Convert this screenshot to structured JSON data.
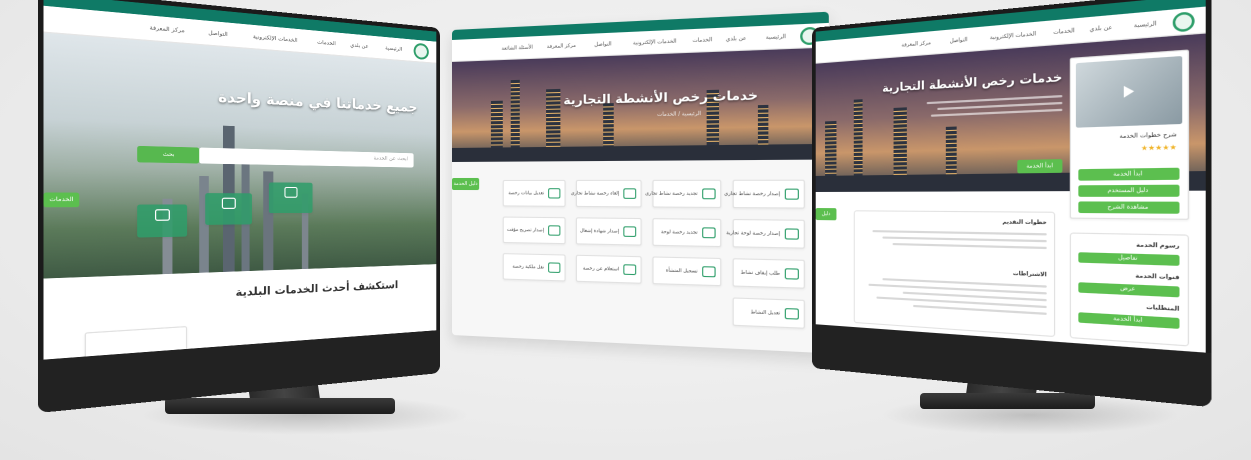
{
  "left_screen": {
    "hero_title_line1": "جميع خدماتنا في منصة واحدة",
    "search_placeholder": "ابحث عن الخدمة",
    "search_button": "بحث",
    "quick_tag": "الخدمات",
    "section_title": "استكشف أحدث الخدمات البلدية",
    "nav_items": [
      "الرئيسية",
      "عن بلدي",
      "الخدمات",
      "الخدمات الإلكترونية",
      "التواصل",
      "مركز المعرفة"
    ]
  },
  "middle_screen": {
    "hero_title": "خدمات رخص الأنشطة التجارية",
    "hero_sub": "الرئيسية / الخدمات",
    "side_tag": "دليل الخدمة",
    "nav_items": [
      "الرئيسية",
      "عن بلدي",
      "الخدمات",
      "الخدمات الإلكترونية",
      "التواصل",
      "مركز المعرفة",
      "الأسئلة الشائعة"
    ],
    "services": [
      "إصدار رخصة نشاط تجاري",
      "تجديد رخصة نشاط تجاري",
      "إلغاء رخصة نشاط تجاري",
      "تعديل بيانات رخصة",
      "إصدار رخصة لوحة تجارية",
      "تجديد رخصة لوحة",
      "إصدار شهادة إشغال",
      "إصدار تصريح مؤقت",
      "طلب إيقاف نشاط",
      "تسجيل المنشأة",
      "استعلام عن رخصة",
      "نقل ملكية رخصة",
      "تعديل النشاط"
    ]
  },
  "right_screen": {
    "hero_title": "خدمات رخص الأنشطة التجارية",
    "cta_button": "ابدأ الخدمة",
    "video_title": "شرح خطوات الخدمة",
    "rating_stars": "★★★★★",
    "side_tag": "دليل",
    "panel_title_1": "خطوات التقديم",
    "panel_title_2": "الاشتراطات",
    "sidebar_title_1": "رسوم الخدمة",
    "sidebar_title_2": "قنوات الخدمة",
    "sidebar_title_3": "المتطلبات",
    "sidebar_buttons": [
      "ابدأ الخدمة",
      "دليل المستخدم",
      "مشاهدة الشرح",
      "تفاصيل",
      "عرض"
    ],
    "nav_items": [
      "الرئيسية",
      "عن بلدي",
      "الخدمات",
      "الخدمات الإلكترونية",
      "التواصل",
      "مركز المعرفة"
    ]
  },
  "colors": {
    "brand_green": "#0f7a66",
    "accent_green": "#5cbf4f",
    "bezel": "#1b1b1b"
  }
}
